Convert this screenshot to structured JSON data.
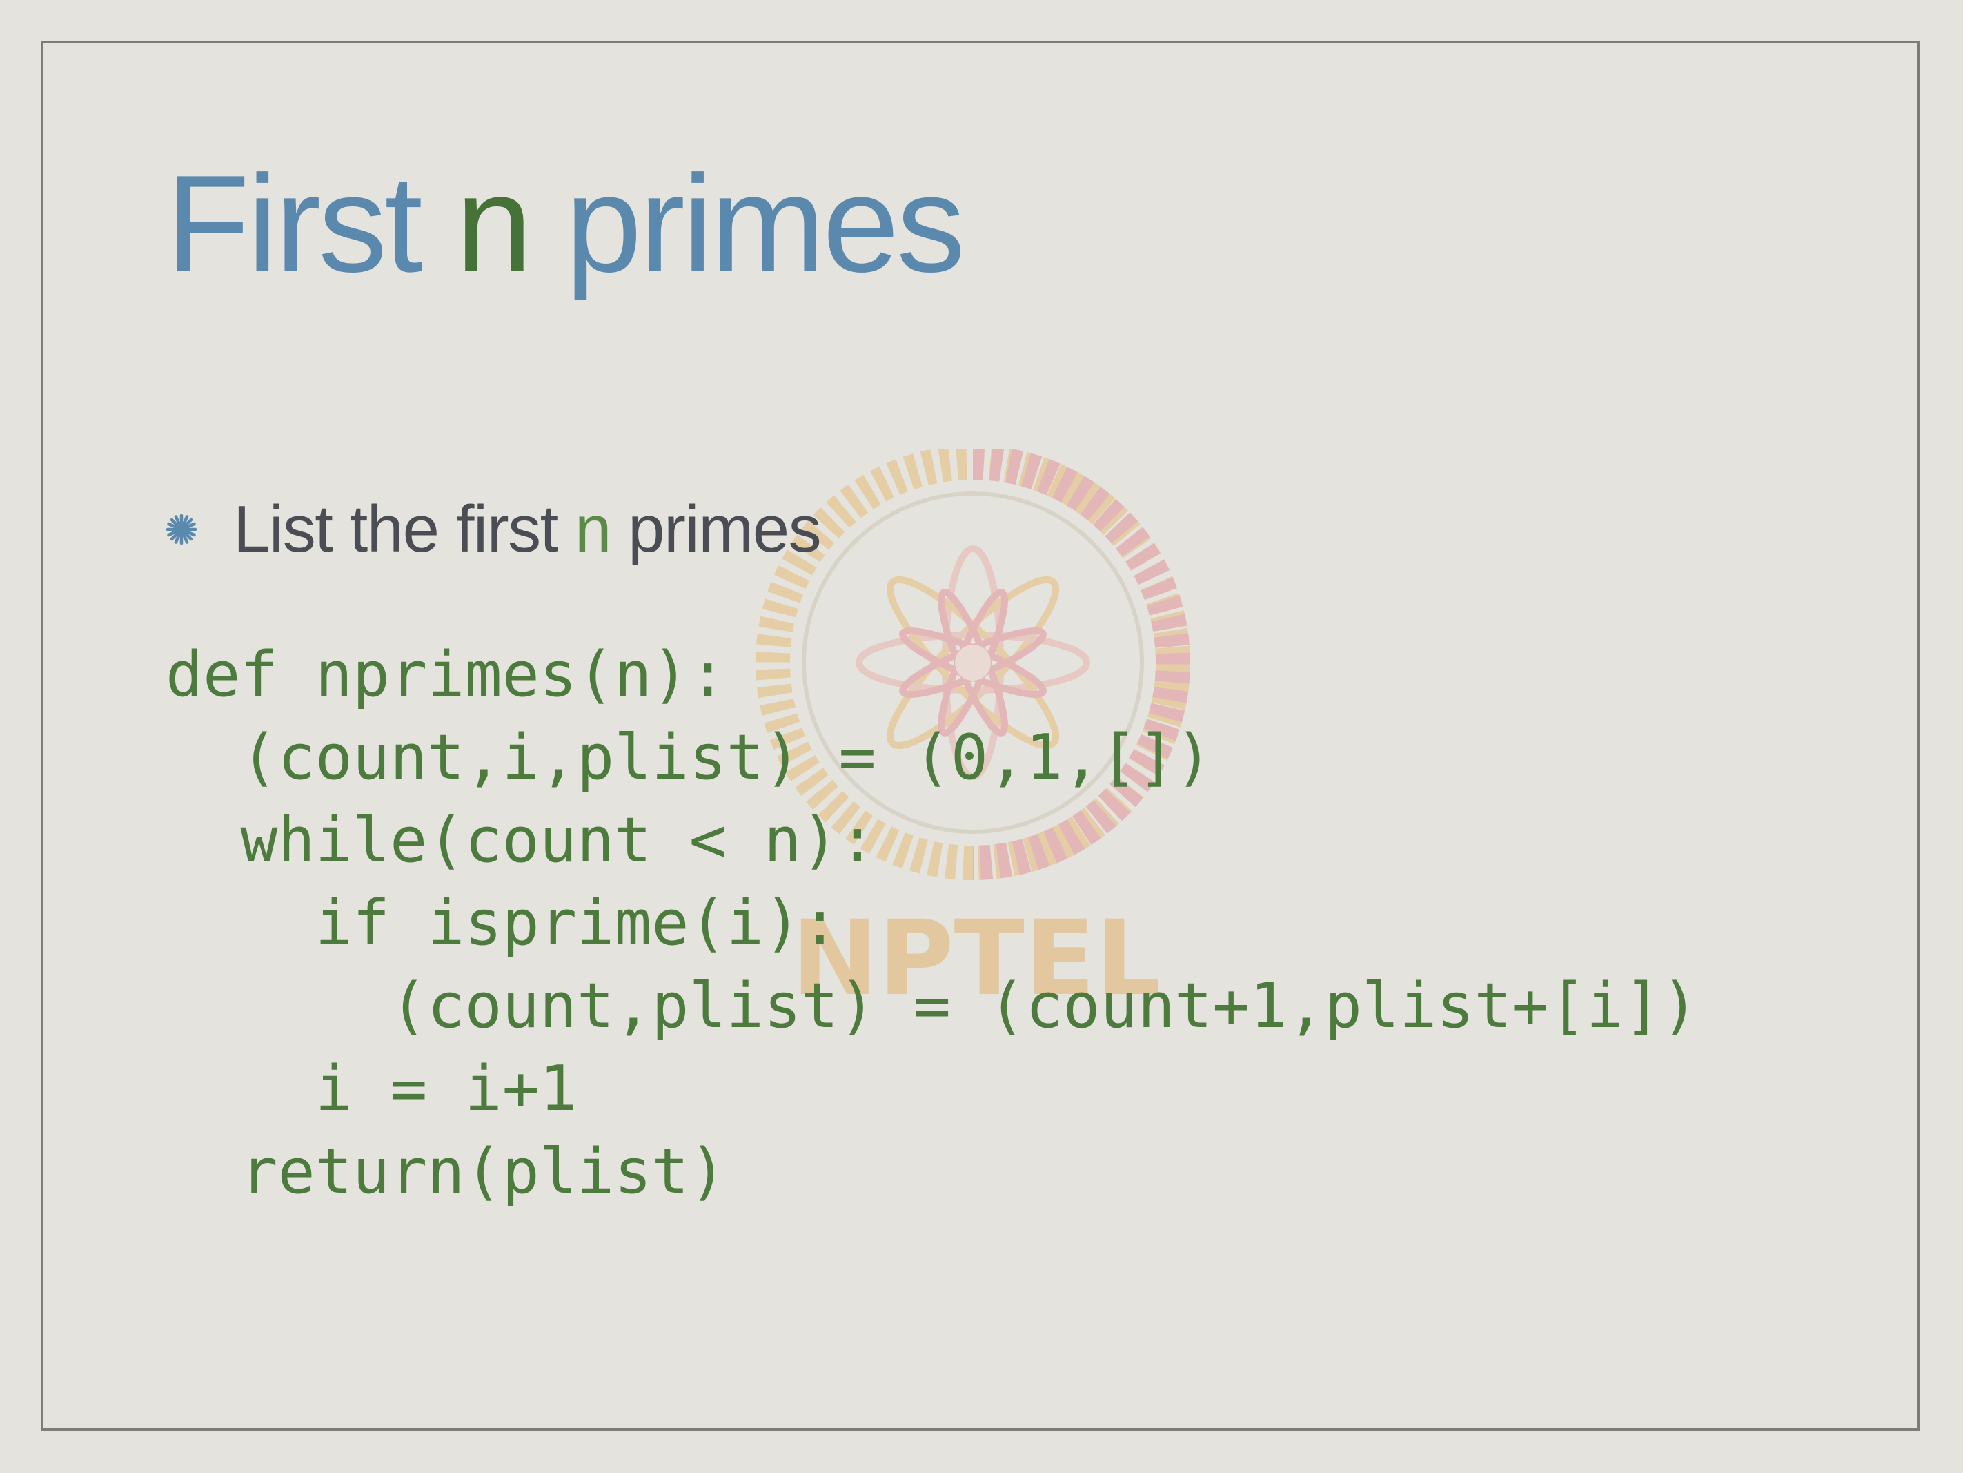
{
  "slide": {
    "title_pre": "First ",
    "title_highlight": "n",
    "title_post": " primes",
    "bullet": {
      "icon": "asterisk-bullet-icon",
      "text_pre": "List the first ",
      "text_highlight": "n",
      "text_post": " primes"
    },
    "code_lines": [
      "def nprimes(n):",
      "  (count,i,plist) = (0,1,[])",
      "  while(count < n):",
      "    if isprime(i):",
      "      (count,plist) = (count+1,plist+[i])",
      "    i = i+1",
      "  return(plist)"
    ]
  },
  "watermark": {
    "text": "NPTEL",
    "icon": "nptel-logo-icon"
  },
  "colors": {
    "title": "#5a89ad",
    "title_highlight": "#467137",
    "code": "#4d7a3d",
    "bullet_text": "#4a4d54",
    "bullet_highlight": "#5c8a48",
    "background": "#e4e3de",
    "frame": "#7d7c78"
  }
}
